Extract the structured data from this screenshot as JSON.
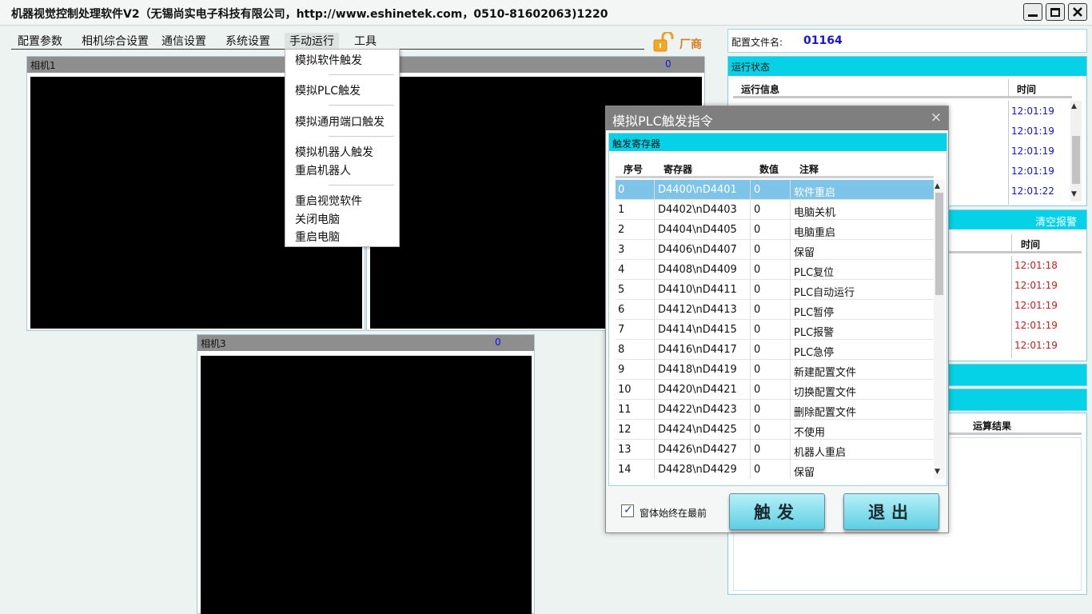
{
  "window": {
    "title": "机器视觉控制处理软件V2（无锡尚实电子科技有限公司，http://www.eshinetek.com，0510-81602063)1220"
  },
  "menu": {
    "items": [
      "配置参数",
      "相机综合设置",
      "通信设置",
      "系统设置",
      "手动运行",
      "工具"
    ],
    "vendor_label": "厂商"
  },
  "dropdown": {
    "items": [
      "模拟软件触发",
      "模拟PLC触发",
      "模拟通用端口触发",
      "模拟机器人触发",
      "重启机器人",
      "重启视觉软件",
      "关闭电脑",
      "重启电脑"
    ]
  },
  "cameras": [
    {
      "name": "相机1",
      "count": ""
    },
    {
      "name": "",
      "count": "0"
    },
    {
      "name": "相机3",
      "count": "0"
    }
  ],
  "config": {
    "label": "配置文件名:",
    "value": "01164"
  },
  "run_status": {
    "title": "运行状态",
    "col_info": "运行信息",
    "col_time": "时间",
    "times": [
      "12:01:19",
      "12:01:19",
      "12:01:19",
      "12:01:19",
      "12:01:22"
    ]
  },
  "alarms": {
    "clear_label": "清空报警",
    "col_time": "时间",
    "times": [
      "12:01:18",
      "12:01:19",
      "12:01:19",
      "12:01:19",
      "12:01:19"
    ]
  },
  "results": {
    "col_result": "运算结果"
  },
  "dialog": {
    "title": "模拟PLC触发指令",
    "close": "×",
    "group_label": "触发寄存器",
    "headers": {
      "index": "序号",
      "register": "寄存器",
      "value": "数值",
      "note": "注释"
    },
    "rows": [
      {
        "i": "0",
        "reg": "D4400\\nD4401",
        "val": "0",
        "note": "软件重启"
      },
      {
        "i": "1",
        "reg": "D4402\\nD4403",
        "val": "0",
        "note": "电脑关机"
      },
      {
        "i": "2",
        "reg": "D4404\\nD4405",
        "val": "0",
        "note": "电脑重启"
      },
      {
        "i": "3",
        "reg": "D4406\\nD4407",
        "val": "0",
        "note": "保留"
      },
      {
        "i": "4",
        "reg": "D4408\\nD4409",
        "val": "0",
        "note": "PLC复位"
      },
      {
        "i": "5",
        "reg": "D4410\\nD4411",
        "val": "0",
        "note": "PLC自动运行"
      },
      {
        "i": "6",
        "reg": "D4412\\nD4413",
        "val": "0",
        "note": "PLC暂停"
      },
      {
        "i": "7",
        "reg": "D4414\\nD4415",
        "val": "0",
        "note": "PLC报警"
      },
      {
        "i": "8",
        "reg": "D4416\\nD4417",
        "val": "0",
        "note": "PLC急停"
      },
      {
        "i": "9",
        "reg": "D4418\\nD4419",
        "val": "0",
        "note": "新建配置文件"
      },
      {
        "i": "10",
        "reg": "D4420\\nD4421",
        "val": "0",
        "note": "切换配置文件"
      },
      {
        "i": "11",
        "reg": "D4422\\nD4423",
        "val": "0",
        "note": "删除配置文件"
      },
      {
        "i": "12",
        "reg": "D4424\\nD4425",
        "val": "0",
        "note": "不使用"
      },
      {
        "i": "13",
        "reg": "D4426\\nD4427",
        "val": "0",
        "note": "机器人重启"
      },
      {
        "i": "14",
        "reg": "D4428\\nD4429",
        "val": "0",
        "note": "保留"
      }
    ],
    "checkbox_label": "窗体始终在最前",
    "checkbox_checked": true,
    "trigger_button": "触发",
    "exit_button": "退出"
  },
  "colors": {
    "accent": "#05d2e6",
    "selected_row": "#7ec3e8",
    "time_blue": "#1212d6",
    "time_red": "#d21818"
  }
}
